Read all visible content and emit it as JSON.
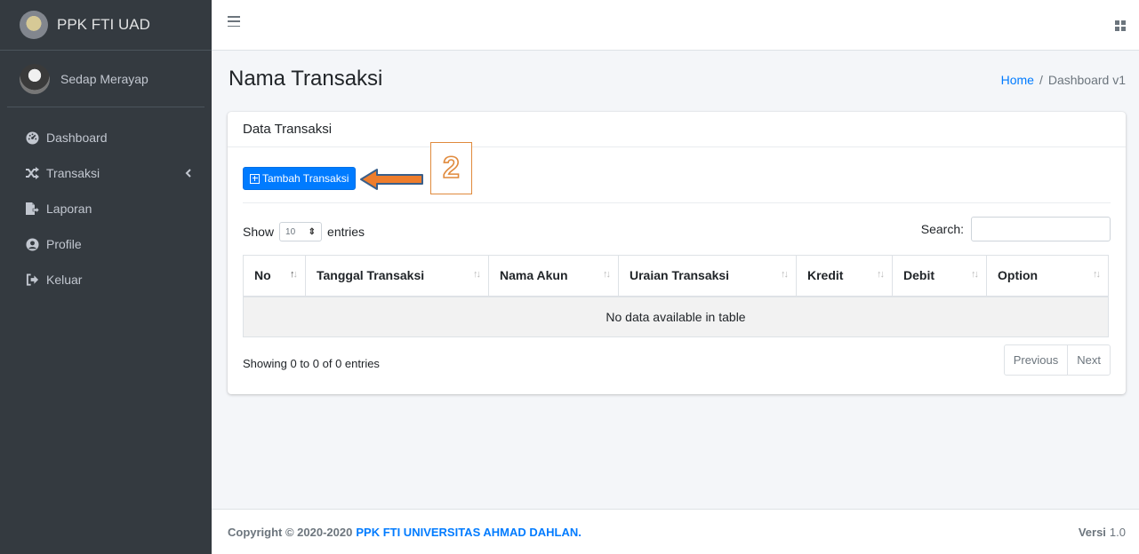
{
  "brand": {
    "title": "PPK FTI UAD"
  },
  "user": {
    "name": "Sedap Merayap"
  },
  "sidebar": {
    "items": [
      {
        "label": "Dashboard",
        "icon": "tachometer-icon"
      },
      {
        "label": "Transaksi",
        "icon": "shuffle-icon"
      },
      {
        "label": "Laporan",
        "icon": "file-export-icon"
      },
      {
        "label": "Profile",
        "icon": "user-circle-icon"
      },
      {
        "label": "Keluar",
        "icon": "sign-out-icon"
      }
    ]
  },
  "page": {
    "title": "Nama Transaksi"
  },
  "breadcrumb": {
    "home": "Home",
    "separator": "/",
    "current": "Dashboard v1"
  },
  "card": {
    "title": "Data Transaksi",
    "add_button": "Tambah Transaksi",
    "show_label": "Show",
    "entries_value": "10",
    "entries_label": "entries",
    "search_label": "Search:",
    "columns": [
      "No",
      "Tanggal Transaksi",
      "Nama Akun",
      "Uraian Transaksi",
      "Kredit",
      "Debit",
      "Option"
    ],
    "empty_message": "No data available in table",
    "info": "Showing 0 to 0 of 0 entries",
    "prev_label": "Previous",
    "next_label": "Next"
  },
  "annotation": {
    "number": "2",
    "color": "#e67e22"
  },
  "footer": {
    "copyright": "Copyright © 2020-2020",
    "org": "PPK FTI UNIVERSITAS AHMAD DAHLAN.",
    "version_label": "Versi",
    "version_number": "1.0"
  },
  "colors": {
    "sidebar": "#343a40",
    "primary": "#007bff",
    "background": "#f4f6f9"
  }
}
